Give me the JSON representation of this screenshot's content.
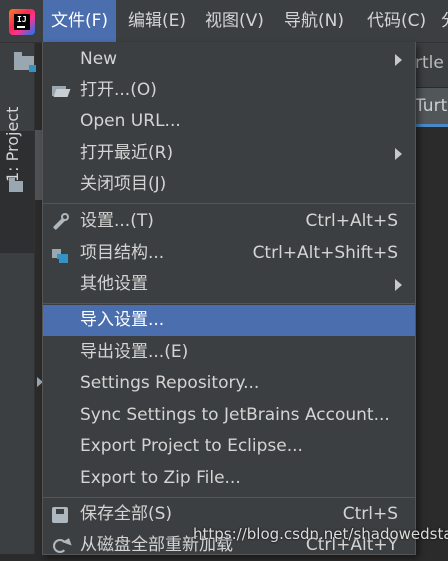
{
  "colors": {
    "selection": "#4b6eaf",
    "menu_bg": "#3c3f41",
    "editor_bg": "#2b2b2b"
  },
  "menubar": {
    "logo_letters": "IJ",
    "items": [
      "文件(F)",
      "编辑(E)",
      "视图(V)",
      "导航(N)",
      "代码(C)",
      "分"
    ]
  },
  "toolwindow": {
    "project_tab": "1: Project"
  },
  "background": {
    "breadcrumb_fragment": "rtle",
    "editor_tab_fragment": "Turt"
  },
  "file_menu": {
    "items": [
      {
        "label": "New",
        "submenu": true
      },
      {
        "label": "打开...(O)",
        "icon": "folder-open-icon"
      },
      {
        "label": "Open URL..."
      },
      {
        "label": "打开最近(R)",
        "submenu": true
      },
      {
        "label": "关闭项目(J)"
      },
      {
        "label": "设置...(T)",
        "icon": "wrench-icon",
        "shortcut": "Ctrl+Alt+S"
      },
      {
        "label": "项目结构...",
        "icon": "project-structure-icon",
        "shortcut": "Ctrl+Alt+Shift+S"
      },
      {
        "label": "其他设置",
        "submenu": true
      },
      {
        "label": "导入设置...",
        "selected": true
      },
      {
        "label": "导出设置...(E)"
      },
      {
        "label": "Settings Repository..."
      },
      {
        "label": "Sync Settings to JetBrains Account..."
      },
      {
        "label": "Export Project to Eclipse..."
      },
      {
        "label": "Export to Zip File..."
      },
      {
        "label": "保存全部(S)",
        "icon": "save-icon",
        "shortcut": "Ctrl+S"
      },
      {
        "label": "从磁盘全部重新加载",
        "icon": "reload-icon",
        "shortcut": "Ctrl+Alt+Y"
      }
    ]
  },
  "watermark": "https://blog.csdn.net/shadowedstar"
}
